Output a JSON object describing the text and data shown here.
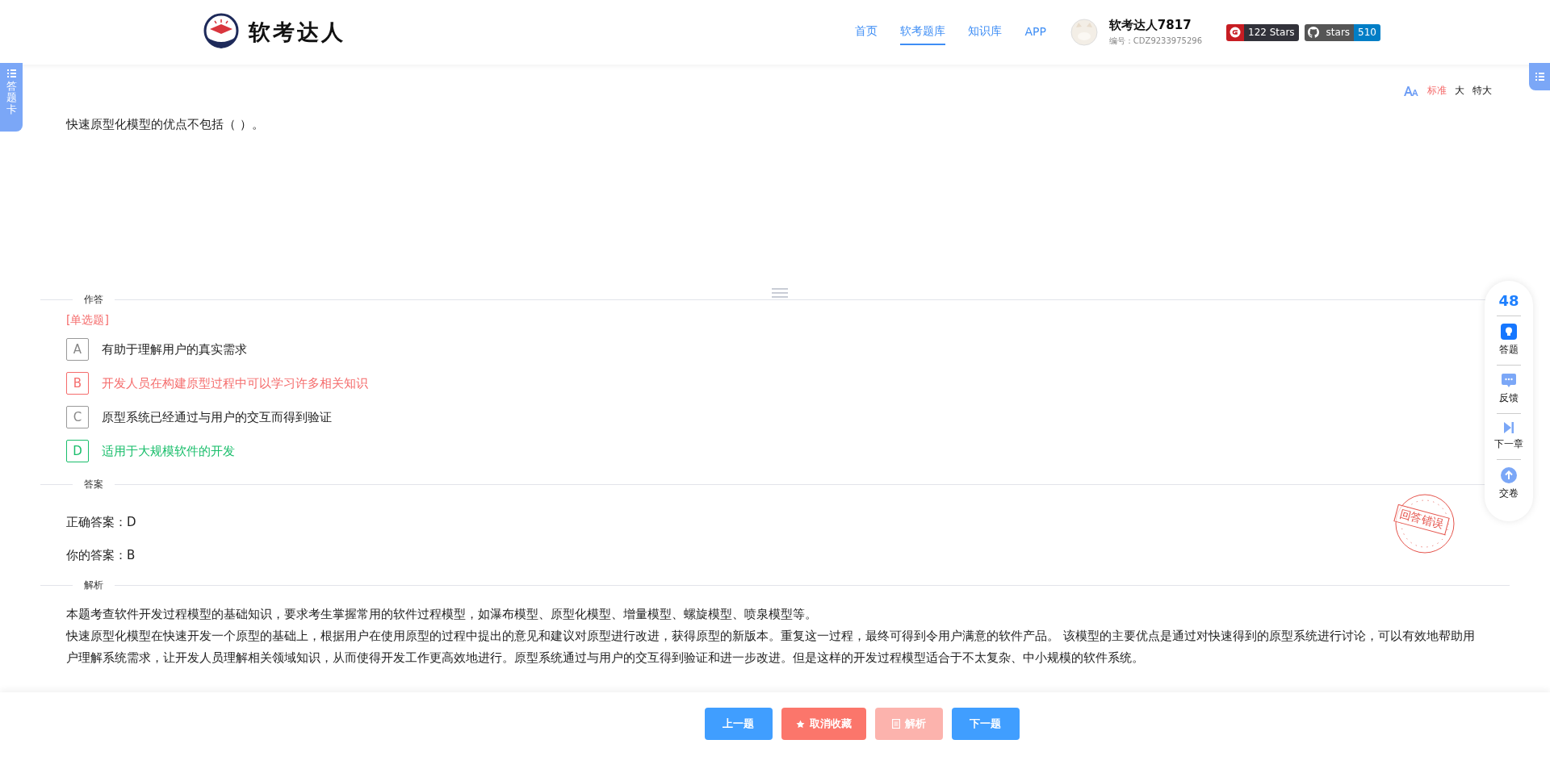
{
  "header": {
    "logo_text": "软考达人",
    "nav": [
      {
        "label": "首页",
        "selected": false
      },
      {
        "label": "软考题库",
        "selected": true
      },
      {
        "label": "知识库",
        "selected": false
      },
      {
        "label": "APP",
        "selected": false
      }
    ],
    "user": {
      "name": "软考达人7817",
      "id_label": "编号：CDZ9233975296"
    },
    "badges": [
      {
        "kind": "gitee",
        "label": "122 Stars"
      },
      {
        "kind": "github",
        "label": "stars",
        "count": "510"
      }
    ]
  },
  "answer_card_tab": "答题卡",
  "font_sizes": [
    {
      "label": "标准",
      "selected": true
    },
    {
      "label": "大",
      "selected": false
    },
    {
      "label": "特大",
      "selected": false
    }
  ],
  "question": "快速原型化模型的优点不包括（ ）。",
  "answer_section": {
    "title": "作答",
    "type_label": "[单选题]",
    "options": [
      {
        "letter": "A",
        "text": "有助于理解用户的真实需求",
        "selected": false,
        "correct": false
      },
      {
        "letter": "B",
        "text": "开发人员在构建原型过程中可以学习许多相关知识",
        "selected": true,
        "correct": false
      },
      {
        "letter": "C",
        "text": "原型系统已经通过与用户的交互而得到验证",
        "selected": false,
        "correct": false
      },
      {
        "letter": "D",
        "text": "适用于大规模软件的开发",
        "selected": false,
        "correct": true
      }
    ]
  },
  "result_section": {
    "title": "答案",
    "correct_answer": "正确答案：D",
    "your_answer": "你的答案：B",
    "stamp": "回答错误"
  },
  "analysis_section": {
    "title": "解析",
    "paragraphs": [
      "本题考查软件开发过程模型的基础知识，要求考生掌握常用的软件过程模型，如瀑布模型、原型化模型、增量模型、螺旋模型、喷泉模型等。",
      "快速原型化模型在快速开发一个原型的基础上，根据用户在使用原型的过程中提出的意见和建议对原型进行改进，获得原型的新版本。重复这一过程，最终可得到令用户满意的软件产品。 该模型的主要优点是通过对快速得到的原型系统进行讨论，可以有效地帮助用户理解系统需求，让开发人员理解相关领域知识，从而使得开发工作更高效地进行。原型系统通过与用户的交互得到验证和进一步改进。但是这样的开发过程模型适合于不太复杂、中小规模的软件系统。"
    ]
  },
  "side_panel": {
    "number": "48",
    "items": [
      {
        "kind": "answer",
        "label": "答题"
      },
      {
        "kind": "feedback",
        "label": "反馈"
      },
      {
        "kind": "next_chapter",
        "label": "下一章"
      },
      {
        "kind": "submit",
        "label": "交卷"
      }
    ]
  },
  "footer_buttons": [
    {
      "kind": "prev",
      "label": "上一题",
      "disabled": false
    },
    {
      "kind": "favorite",
      "label": "取消收藏",
      "disabled": false
    },
    {
      "kind": "analysis",
      "label": "解析",
      "disabled": true
    },
    {
      "kind": "next",
      "label": "下一题",
      "disabled": false
    }
  ]
}
